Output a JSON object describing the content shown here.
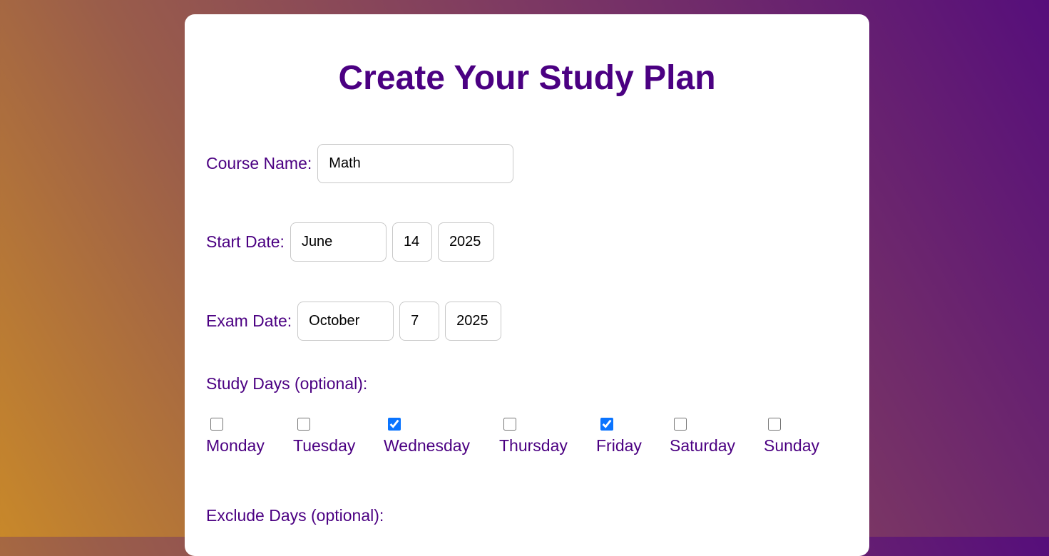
{
  "form": {
    "title": "Create Your Study Plan",
    "course_label": "Course Name:",
    "course_value": "Math",
    "start_label": "Start Date:",
    "start_month": "June",
    "start_day": "14",
    "start_year": "2025",
    "exam_label": "Exam Date:",
    "exam_month": "October",
    "exam_day": "7",
    "exam_year": "2025",
    "study_days_label": "Study Days (optional):",
    "exclude_days_label": "Exclude Days (optional):",
    "days": [
      {
        "label": "Monday",
        "checked": false
      },
      {
        "label": "Tuesday",
        "checked": false
      },
      {
        "label": "Wednesday",
        "checked": true
      },
      {
        "label": "Thursday",
        "checked": false
      },
      {
        "label": "Friday",
        "checked": true
      },
      {
        "label": "Saturday",
        "checked": false
      },
      {
        "label": "Sunday",
        "checked": false
      }
    ]
  },
  "colors": {
    "accent": "#4b0082",
    "checkbox": "#0a74ff"
  }
}
